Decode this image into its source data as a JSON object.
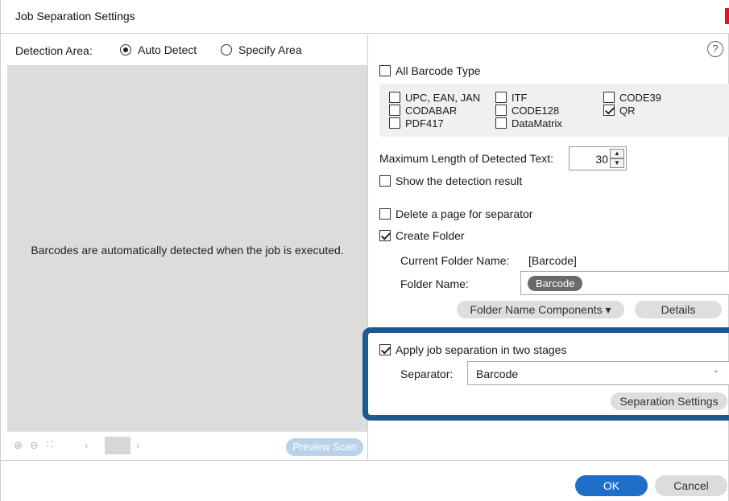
{
  "window": {
    "title": "Job Separation Settings"
  },
  "detection": {
    "label": "Detection Area:",
    "options": [
      {
        "label": "Auto Detect",
        "selected": true
      },
      {
        "label": "Specify Area",
        "selected": false
      }
    ]
  },
  "preview": {
    "message": "Barcodes are automatically detected when the job is executed.",
    "preview_scan_label": "Preview Scan",
    "toolbar_icons": [
      "zoom-in-icon",
      "zoom-out-icon",
      "fit-icon",
      "prev-page-icon",
      "next-page-icon"
    ]
  },
  "barcode": {
    "all_type_label": "All Barcode Type",
    "all_type_checked": false,
    "types": [
      {
        "label": "UPC, EAN, JAN",
        "checked": false
      },
      {
        "label": "ITF",
        "checked": false
      },
      {
        "label": "CODE39",
        "checked": false
      },
      {
        "label": "CODABAR",
        "checked": false
      },
      {
        "label": "CODE128",
        "checked": false
      },
      {
        "label": "QR",
        "checked": true
      },
      {
        "label": "PDF417",
        "checked": false
      },
      {
        "label": "DataMatrix",
        "checked": false
      }
    ]
  },
  "settings": {
    "max_length_label": "Maximum Length of Detected Text:",
    "max_length_value": "30",
    "show_result_label": "Show the detection result",
    "show_result_checked": false,
    "delete_page_label": "Delete a page for separator",
    "delete_page_checked": false,
    "create_folder_label": "Create Folder",
    "create_folder_checked": true,
    "current_folder_label": "Current Folder Name:",
    "current_folder_value": "[Barcode]",
    "folder_name_label": "Folder Name:",
    "folder_name_token": "Barcode",
    "folder_components_label": "Folder Name Components",
    "details_label": "Details"
  },
  "two_stage": {
    "apply_label": "Apply job separation in two stages",
    "apply_checked": true,
    "separator_label": "Separator:",
    "separator_value": "Barcode",
    "separation_settings_label": "Separation Settings",
    "highlight_color": "#1d5a8f"
  },
  "footer": {
    "ok_label": "OK",
    "cancel_label": "Cancel"
  },
  "colors": {
    "ok": "#1f6fc8",
    "preview_scan": "#b9d2ea",
    "close": "#e81123"
  }
}
